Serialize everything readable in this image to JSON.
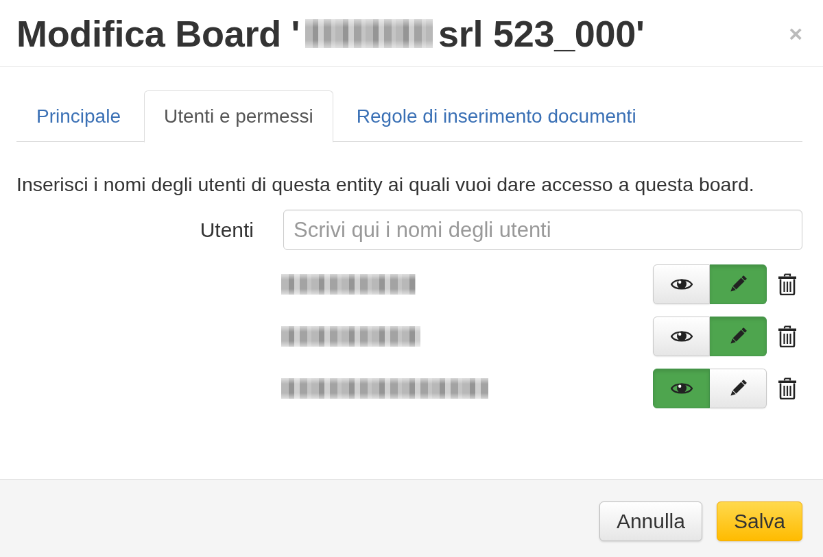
{
  "dialog": {
    "title_before_redaction": "Modifica Board '",
    "title_after_redaction": "srl 523_000'",
    "close": "×"
  },
  "tabs": [
    {
      "label": "Principale",
      "selected": false
    },
    {
      "label": "Utenti e permessi",
      "selected": true
    },
    {
      "label": "Regole di inserimento documenti",
      "selected": false
    }
  ],
  "description": "Inserisci i nomi degli utenti di questa entity ai quali vuoi dare accesso a questa board.",
  "users_field": {
    "label": "Utenti",
    "placeholder": "Scrivi qui i nomi degli utenti"
  },
  "users": [
    {
      "permissions": [
        {
          "kind": "view",
          "selected": false
        },
        {
          "kind": "edit",
          "selected": true
        }
      ]
    },
    {
      "permissions": [
        {
          "kind": "view",
          "selected": false
        },
        {
          "kind": "edit",
          "selected": true
        }
      ]
    },
    {
      "permissions": [
        {
          "kind": "view",
          "selected": true
        },
        {
          "kind": "edit",
          "selected": false
        }
      ]
    }
  ],
  "buttons": [
    {
      "label": "Annulla",
      "kind": "default"
    },
    {
      "label": "Salva",
      "kind": "primary"
    }
  ]
}
